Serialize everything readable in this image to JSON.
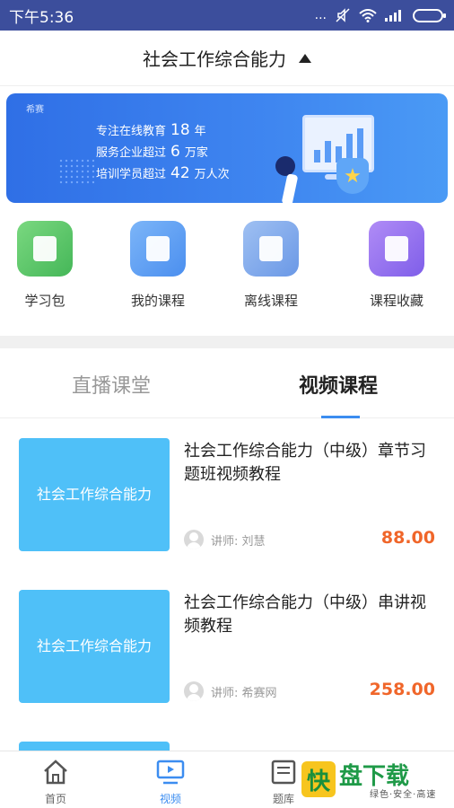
{
  "status_bar": {
    "time": "下午5:36",
    "signal_text": "..."
  },
  "header": {
    "title": "社会工作综合能力"
  },
  "banner": {
    "brand": "希赛",
    "lines": [
      {
        "pre": "专注在线教育",
        "num": "18",
        "post": "年"
      },
      {
        "pre": "服务企业超过",
        "num": "6",
        "post": "万家"
      },
      {
        "pre": "培训学员超过",
        "num": "42",
        "post": "万人次"
      }
    ]
  },
  "quick_actions": [
    {
      "label": "学习包",
      "icon": "book-icon",
      "color": "#5ac864"
    },
    {
      "label": "我的课程",
      "icon": "video-lesson-icon",
      "color": "#5a9cf3"
    },
    {
      "label": "离线课程",
      "icon": "offline-icon",
      "color": "#6f9fe8"
    },
    {
      "label": "课程收藏",
      "icon": "favorite-icon",
      "color": "#8e6ef0"
    }
  ],
  "tabs": [
    {
      "label": "直播课堂",
      "active": false
    },
    {
      "label": "视频课程",
      "active": true
    }
  ],
  "courses": [
    {
      "thumb_text": "社会工作综合能力",
      "title": "社会工作综合能力（中级）章节习题班视频教程",
      "teacher": "讲师: 刘慧",
      "price": "88.00"
    },
    {
      "thumb_text": "社会工作综合能力",
      "title": "社会工作综合能力（中级）串讲视频教程",
      "teacher": "讲师: 希赛网",
      "price": "258.00"
    }
  ],
  "nav": [
    {
      "label": "首页",
      "icon": "home-icon",
      "active": false
    },
    {
      "label": "视频",
      "icon": "tv-icon",
      "active": true
    },
    {
      "label": "题库",
      "icon": "question-bank-icon",
      "active": false
    }
  ],
  "watermark": {
    "logo": "快",
    "name": "盘下载",
    "slogan": "绿色·安全·高速"
  },
  "colors": {
    "primary": "#3c8df0",
    "status_bar": "#3c4e9c",
    "price": "#f0662a",
    "thumb": "#4fc0f8"
  }
}
